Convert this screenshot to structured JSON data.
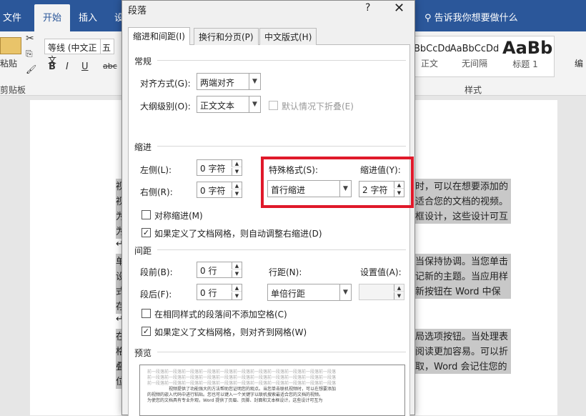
{
  "ribbon": {
    "tabs": [
      "文件",
      "开始",
      "插入",
      "设"
    ],
    "tell_me": "告诉我你想要做什么",
    "paste_label": "粘贴",
    "clipboard_label": "剪贴板",
    "font_name": "等线 (中文正文",
    "font_size": "五",
    "format_buttons": [
      "B",
      "I",
      "U",
      "abc"
    ],
    "styles": [
      {
        "preview": "BbCcDd",
        "name": "正文"
      },
      {
        "preview": "AaBbCcDd",
        "name": "无间隔"
      },
      {
        "preview": "AaBb",
        "name": "标题 1"
      }
    ],
    "styles_group_label": "样式",
    "edit_label": "编"
  },
  "dialog": {
    "title": "段落",
    "help": "?",
    "close": "✕",
    "tabs": [
      "缩进和间距(I)",
      "换行和分页(P)",
      "中文版式(H)"
    ],
    "general": {
      "heading": "常规",
      "alignment_label": "对齐方式(G):",
      "alignment_value": "两端对齐",
      "outline_label": "大纲级别(O):",
      "outline_value": "正文文本",
      "collapse_label": "默认情况下折叠(E)"
    },
    "indent": {
      "heading": "缩进",
      "left_label": "左侧(L):",
      "left_value": "0 字符",
      "right_label": "右侧(R):",
      "right_value": "0 字符",
      "special_label": "特殊格式(S):",
      "special_value": "首行缩进",
      "by_label": "缩进值(Y):",
      "by_value": "2 字符",
      "mirror_label": "对称缩进(M)",
      "auto_adjust_label": "如果定义了文档网格，则自动调整右缩进(D)"
    },
    "spacing": {
      "heading": "间距",
      "before_label": "段前(B):",
      "before_value": "0 行",
      "after_label": "段后(F):",
      "after_value": "0 行",
      "line_label": "行距(N):",
      "line_value": "单倍行距",
      "at_label": "设置值(A):",
      "no_space_label": "在相同样式的段落间不添加空格(C)",
      "snap_grid_label": "如果定义了文档网格，则对齐到网格(W)"
    },
    "preview": {
      "heading": "预览",
      "prev_para": "前一段落前一段落前一段落前一段落前一段落前一段落前一段落前一段落前一段落前一段落前一段落",
      "sample_1": "视频提供了功能强大的方法帮助您证明您的观点。当您单击联机视频时，可以在想要添加",
      "sample_2": "的视频的嵌入代码中进行粘贴。您也可以键入一个关键字以联机搜索最适合您的文档的视频。",
      "sample_3": "为使您的文档具有专业外观，Word 提供了页眉、页脚、封面和文本框设计，这些设计可互为"
    }
  },
  "document": {
    "lines": [
      {
        "left": "视",
        "right": "时，可以在想要添加的",
        "hl": true
      },
      {
        "left": "视",
        "right": "适合您的文档的视频。",
        "hl": true
      },
      {
        "left": "为",
        "right": "框设计，这些设计可互",
        "hl": true
      },
      {
        "left": "为",
        "right": "",
        "hl": true
      },
      {
        "left": "↵",
        "right": "",
        "hl": false
      },
      {
        "left": "单",
        "right": "当保持协调。当您单击",
        "hl": true
      },
      {
        "left": "设",
        "right": "记新的主题。当应用样",
        "hl": true
      },
      {
        "left": "式",
        "right": "新按钮在 Word 中保",
        "hl": true
      },
      {
        "left": "存",
        "right": "",
        "hl": true
      },
      {
        "left": "↵",
        "right": "",
        "hl": false
      },
      {
        "left": "在",
        "right": "局选项按钮。当处理表",
        "hl": true
      },
      {
        "left": "格",
        "right": "阅读更加容易。可以折",
        "hl": true
      },
      {
        "left": "叠",
        "right": "取，Word 会记住您的",
        "hl": true
      },
      {
        "left": "位",
        "right": "",
        "hl": true
      }
    ]
  },
  "colors": {
    "ribbon_blue": "#2b579a",
    "highlight_red": "#e0192a"
  }
}
